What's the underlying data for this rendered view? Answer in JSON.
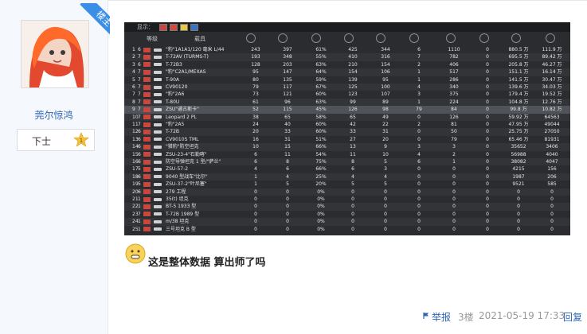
{
  "user": {
    "name": "莞尔惊鸿",
    "rank": "下士",
    "badge_num": "1",
    "role_ribbon": "楼主"
  },
  "shot": {
    "display_label": "显示：",
    "headers": {
      "level": "等级",
      "vehicle": "载具"
    },
    "rows": [
      {
        "n": "1",
        "lv": "6",
        "name": "\"豹\"1A1A1/120 毫米 L/44",
        "c": [
          "243",
          "397",
          "61%",
          "425",
          "344",
          "6",
          "1110",
          "0",
          "880.5 万",
          "111.9 万"
        ]
      },
      {
        "n": "2",
        "lv": "7",
        "name": "T-72AV (TURMS-T)",
        "c": [
          "193",
          "348",
          "55%",
          "410",
          "316",
          "7",
          "782",
          "0",
          "695.5 万",
          "89.42 万"
        ]
      },
      {
        "n": "3",
        "lv": "6",
        "name": "T-72B3",
        "c": [
          "128",
          "203",
          "63%",
          "210",
          "154",
          "2",
          "406",
          "0",
          "205.8 万",
          "46.27 万"
        ]
      },
      {
        "n": "4",
        "lv": "7",
        "name": "\"豹\"C2A1/MEXAS",
        "c": [
          "95",
          "147",
          "64%",
          "154",
          "106",
          "1",
          "517",
          "0",
          "151.1 万",
          "16.14 万"
        ]
      },
      {
        "n": "5",
        "lv": "7",
        "name": "T-90A",
        "c": [
          "80",
          "135",
          "59%",
          "139",
          "95",
          "1",
          "286",
          "0",
          "141.5 万",
          "30.47 万"
        ]
      },
      {
        "n": "6",
        "lv": "7",
        "name": "CV90120",
        "c": [
          "79",
          "117",
          "67%",
          "125",
          "100",
          "4",
          "340",
          "0",
          "139.6 万",
          "34.03 万"
        ]
      },
      {
        "n": "7",
        "lv": "7",
        "name": "\"豹\"2A6",
        "c": [
          "73",
          "121",
          "60%",
          "123",
          "107",
          "3",
          "375",
          "0",
          "179.4 万",
          "19.52 万"
        ]
      },
      {
        "n": "8",
        "lv": "7",
        "name": "T-80U",
        "c": [
          "61",
          "96",
          "63%",
          "99",
          "89",
          "1",
          "224",
          "0",
          "104.8 万",
          "12.76 万"
        ]
      },
      {
        "n": "9",
        "lv": "7",
        "name": "ZSU\"通古斯卡\"",
        "c": [
          "52",
          "115",
          "45%",
          "126",
          "98",
          "79",
          "84",
          "0",
          "99.8 万",
          "10.82 万"
        ]
      },
      {
        "n": "10",
        "lv": "7",
        "name": "Leopard 2 PL",
        "c": [
          "38",
          "65",
          "58%",
          "65",
          "49",
          "0",
          "126",
          "0",
          "59.92 万",
          "64563"
        ]
      },
      {
        "n": "11",
        "lv": "7",
        "name": "\"豹\"2A5",
        "c": [
          "24",
          "40",
          "60%",
          "42",
          "22",
          "2",
          "81",
          "0",
          "47.95 万",
          "49044"
        ]
      },
      {
        "n": "12",
        "lv": "6",
        "name": "T-72B",
        "c": [
          "20",
          "33",
          "60%",
          "33",
          "31",
          "0",
          "50",
          "0",
          "25.75 万",
          "27050"
        ]
      },
      {
        "n": "13",
        "lv": "6",
        "name": "CV9010S TML",
        "c": [
          "16",
          "31",
          "51%",
          "27",
          "20",
          "0",
          "79",
          "0",
          "65.46 万",
          "81931"
        ]
      },
      {
        "n": "14",
        "lv": "6",
        "name": "\"猎豹\"防空坦克",
        "c": [
          "10",
          "15",
          "66%",
          "13",
          "9",
          "3",
          "3",
          "0",
          "35652",
          "3406"
        ]
      },
      {
        "n": "15",
        "lv": "6",
        "name": "ZSU-23-4\"石勒喀\"",
        "c": [
          "6",
          "11",
          "54%",
          "11",
          "10",
          "4",
          "2",
          "0",
          "56988",
          "4040"
        ]
      },
      {
        "n": "16",
        "lv": "6",
        "name": "防空导弹坦克 1 型/\"萨兰\"",
        "c": [
          "6",
          "8",
          "75%",
          "8",
          "5",
          "6",
          "1",
          "0",
          "38082",
          "4047"
        ]
      },
      {
        "n": "17",
        "lv": "5",
        "name": "ZSU-57-2",
        "c": [
          "4",
          "6",
          "66%",
          "6",
          "3",
          "0",
          "0",
          "0",
          "4215",
          "156"
        ]
      },
      {
        "n": "18",
        "lv": "6",
        "name": "9040 型战车\"比尔\"",
        "c": [
          "1",
          "4",
          "25%",
          "4",
          "4",
          "0",
          "0",
          "0",
          "1987",
          "206"
        ]
      },
      {
        "n": "19",
        "lv": "5",
        "name": "ZSU-37-2\"叶尼塞\"",
        "c": [
          "1",
          "5",
          "20%",
          "5",
          "5",
          "0",
          "0",
          "0",
          "9521",
          "585"
        ]
      },
      {
        "n": "20",
        "lv": "6",
        "name": "279 工程",
        "c": [
          "0",
          "0",
          "0%",
          "0",
          "0",
          "0",
          "0",
          "0",
          "0",
          "0"
        ]
      },
      {
        "n": "21",
        "lv": "1",
        "name": "35(t) 坦克",
        "c": [
          "0",
          "0",
          "0%",
          "0",
          "0",
          "0",
          "0",
          "0",
          "0",
          "0"
        ]
      },
      {
        "n": "22",
        "lv": "1",
        "name": "BT-5 1933 型",
        "c": [
          "0",
          "0",
          "0%",
          "0",
          "0",
          "0",
          "0",
          "0",
          "0",
          "0"
        ]
      },
      {
        "n": "23",
        "lv": "7",
        "name": "T-72B 1989 型",
        "c": [
          "0",
          "0",
          "0%",
          "0",
          "0",
          "0",
          "0",
          "0",
          "0",
          "0"
        ]
      },
      {
        "n": "24",
        "lv": "1",
        "name": "m/38 坦克",
        "c": [
          "0",
          "0",
          "0%",
          "0",
          "0",
          "0",
          "0",
          "0",
          "0",
          "0"
        ]
      },
      {
        "n": "25",
        "lv": "1",
        "name": "三号坦克 B 型",
        "c": [
          "0",
          "0",
          "0%",
          "0",
          "0",
          "0",
          "0",
          "0",
          "0",
          "0"
        ]
      }
    ]
  },
  "post": {
    "text": "这是整体数据 算出师了吗"
  },
  "footer": {
    "report": "举报",
    "floor": "3楼",
    "datetime": "2021-05-19 17:33",
    "reply": "回复"
  },
  "colors": {
    "link": "#2d64b3",
    "ribbon": "#3a8ee6",
    "accent_hl": "#50545a"
  }
}
